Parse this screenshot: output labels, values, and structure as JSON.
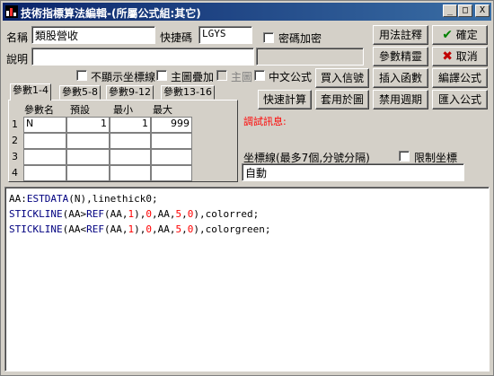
{
  "window": {
    "title": "技術指標算法編輯-(所屬公式組:其它)",
    "min_label": "_",
    "max_label": "□",
    "close_label": "X"
  },
  "form": {
    "name_label": "名稱",
    "name_value": "類股營收",
    "shortcut_label": "快捷碼",
    "shortcut_value": "LGYS",
    "password_label": "密碼加密",
    "desc_label": "說明",
    "desc_value": "",
    "hide_axis_label": "不顯示坐標線",
    "overlay_label": "主圖疊加",
    "main_chart_label": "主圖",
    "chinese_formula_label": "中文公式"
  },
  "buttons": {
    "usage_notes": "用法註釋",
    "confirm": "確定",
    "param_wizard": "參數精靈",
    "cancel": "取消",
    "buy_sell": "買入信號",
    "insert_func": "插入函數",
    "compile": "編譯公式",
    "quick_calc": "快速計算",
    "apply_chart": "套用於圖",
    "disable_period": "禁用週期",
    "import": "匯入公式"
  },
  "tabs": [
    "參數1-4",
    "參數5-8",
    "參數9-12",
    "參數13-16"
  ],
  "params": {
    "headers": [
      "參數名",
      "預設",
      "最小",
      "最大"
    ],
    "rows": [
      {
        "num": "1",
        "name": "N",
        "default": "1",
        "min": "1",
        "max": "999"
      },
      {
        "num": "2",
        "name": "",
        "default": "",
        "min": "",
        "max": ""
      },
      {
        "num": "3",
        "name": "",
        "default": "",
        "min": "",
        "max": ""
      },
      {
        "num": "4",
        "name": "",
        "default": "",
        "min": "",
        "max": ""
      }
    ]
  },
  "debug": {
    "label": "調試訊息:",
    "color": "#ff0000"
  },
  "axis": {
    "label": "坐標線(最多7個,分號分隔)",
    "limit_label": "限制坐標",
    "value": "自動"
  },
  "code": {
    "lines": [
      [
        {
          "t": "AA:",
          "c": "#000000"
        },
        {
          "t": "ESTDATA",
          "c": "#000080"
        },
        {
          "t": "(N),linethick0;",
          "c": "#000000"
        }
      ],
      [
        {
          "t": "STICKLINE",
          "c": "#000080"
        },
        {
          "t": "(AA>",
          "c": "#000000"
        },
        {
          "t": "REF",
          "c": "#000080"
        },
        {
          "t": "(AA,",
          "c": "#000000"
        },
        {
          "t": "1",
          "c": "#ff0000"
        },
        {
          "t": "),",
          "c": "#000000"
        },
        {
          "t": "0",
          "c": "#ff0000"
        },
        {
          "t": ",AA,",
          "c": "#000000"
        },
        {
          "t": "5",
          "c": "#ff0000"
        },
        {
          "t": ",",
          "c": "#000000"
        },
        {
          "t": "0",
          "c": "#ff0000"
        },
        {
          "t": "),colorred;",
          "c": "#000000"
        }
      ],
      [
        {
          "t": "STICKLINE",
          "c": "#000080"
        },
        {
          "t": "(AA<",
          "c": "#000000"
        },
        {
          "t": "REF",
          "c": "#000080"
        },
        {
          "t": "(AA,",
          "c": "#000000"
        },
        {
          "t": "1",
          "c": "#ff0000"
        },
        {
          "t": "),",
          "c": "#000000"
        },
        {
          "t": "0",
          "c": "#ff0000"
        },
        {
          "t": ",AA,",
          "c": "#000000"
        },
        {
          "t": "5",
          "c": "#ff0000"
        },
        {
          "t": ",",
          "c": "#000000"
        },
        {
          "t": "0",
          "c": "#ff0000"
        },
        {
          "t": "),colorgreen;",
          "c": "#000000"
        }
      ]
    ]
  },
  "colors": {
    "confirm_check": "#008000",
    "cancel_x": "#c00000"
  }
}
